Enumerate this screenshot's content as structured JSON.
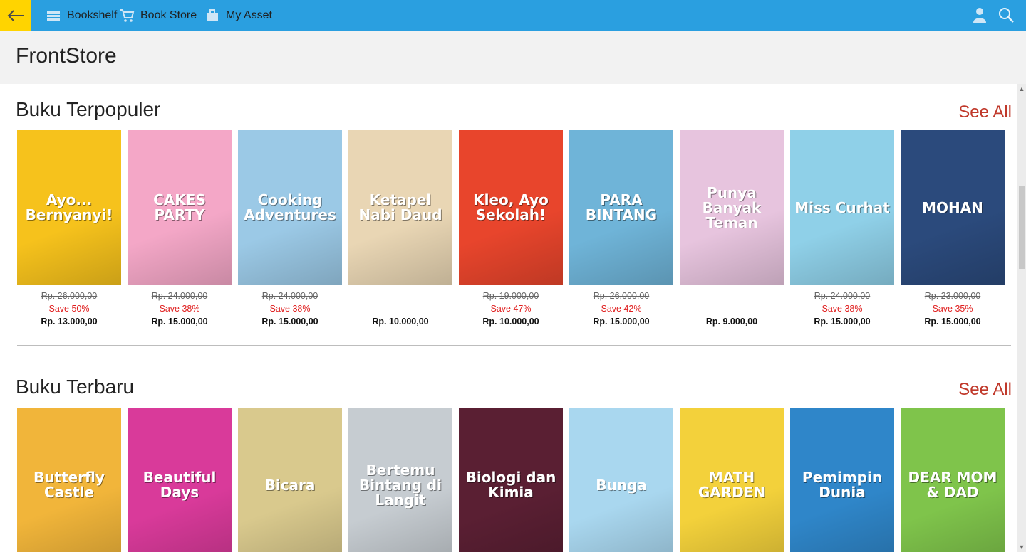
{
  "topbar": {
    "nav": [
      {
        "label": "Bookshelf",
        "icon": "bookshelf-icon"
      },
      {
        "label": "Book Store",
        "icon": "cart-icon"
      },
      {
        "label": "My Asset",
        "icon": "asset-icon"
      }
    ]
  },
  "page": {
    "title": "FrontStore"
  },
  "sections": [
    {
      "title": "Buku Terpopuler",
      "see_all": "See All",
      "books": [
        {
          "cover_text": "Ayo... Bernyanyi!",
          "bg": "#f6c21c",
          "old_price": "Rp. 26.000,00",
          "save": "Save 50%",
          "price": "Rp. 13.000,00"
        },
        {
          "cover_text": "CAKES PARTY",
          "bg": "#f4a7c7",
          "old_price": "Rp. 24.000,00",
          "save": "Save 38%",
          "price": "Rp. 15.000,00"
        },
        {
          "cover_text": "Cooking Adventures",
          "bg": "#9bc9e6",
          "old_price": "Rp. 24.000,00",
          "save": "Save 38%",
          "price": "Rp. 15.000,00"
        },
        {
          "cover_text": "Ketapel Nabi Daud",
          "bg": "#e9d6b4",
          "old_price": "",
          "save": "",
          "price": "Rp. 10.000,00"
        },
        {
          "cover_text": "Kleo, Ayo Sekolah!",
          "bg": "#e8452c",
          "old_price": "Rp. 19.000,00",
          "save": "Save 47%",
          "price": "Rp. 10.000,00"
        },
        {
          "cover_text": "PARA BINTANG",
          "bg": "#6fb4d8",
          "old_price": "Rp. 26.000,00",
          "save": "Save 42%",
          "price": "Rp. 15.000,00"
        },
        {
          "cover_text": "Punya Banyak Teman",
          "bg": "#e7c4de",
          "old_price": "",
          "save": "",
          "price": "Rp. 9.000,00"
        },
        {
          "cover_text": "Miss Curhat",
          "bg": "#8fd0e8",
          "old_price": "Rp. 24.000,00",
          "save": "Save 38%",
          "price": "Rp. 15.000,00"
        },
        {
          "cover_text": "MOHAN",
          "bg": "#2b4a7c",
          "old_price": "Rp. 23.000,00",
          "save": "Save 35%",
          "price": "Rp. 15.000,00"
        }
      ]
    },
    {
      "title": "Buku Terbaru",
      "see_all": "See All",
      "books": [
        {
          "cover_text": "Butterfly Castle",
          "bg": "#f1b53a"
        },
        {
          "cover_text": "Beautiful Days",
          "bg": "#d93a9a"
        },
        {
          "cover_text": "Bicara",
          "bg": "#d9c98d"
        },
        {
          "cover_text": "Bertemu Bintang di Langit",
          "bg": "#c6ccd1"
        },
        {
          "cover_text": "Biologi dan Kimia",
          "bg": "#5a1f33"
        },
        {
          "cover_text": "Bunga",
          "bg": "#a9d7ef"
        },
        {
          "cover_text": "MATH GARDEN",
          "bg": "#f3d13b"
        },
        {
          "cover_text": "Pemimpin Dunia",
          "bg": "#2f86c9"
        },
        {
          "cover_text": "DEAR MOM & DAD",
          "bg": "#7fc44b"
        }
      ]
    }
  ]
}
